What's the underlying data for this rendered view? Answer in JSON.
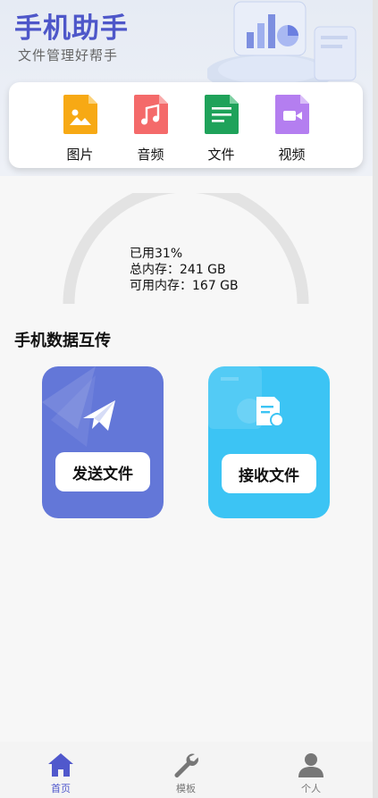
{
  "header": {
    "title": "手机助手",
    "subtitle": "文件管理好帮手"
  },
  "categories": [
    {
      "label": "图片",
      "icon": "image-file-icon",
      "color": "#f7a914"
    },
    {
      "label": "音频",
      "icon": "audio-file-icon",
      "color": "#f46a6a"
    },
    {
      "label": "文件",
      "icon": "document-file-icon",
      "color": "#1fa25a"
    },
    {
      "label": "视频",
      "icon": "video-file-icon",
      "color": "#b47ef0"
    }
  ],
  "storage": {
    "used_label": "已用31%",
    "used_fraction": 0.31,
    "total_line": "总内存：241 GB",
    "free_line": "可用内存：167 GB"
  },
  "transfer": {
    "title": "手机数据互传",
    "send_label": "发送文件",
    "receive_label": "接收文件",
    "send_color": "#6377d8",
    "receive_color": "#3cc4f4"
  },
  "tabbar": {
    "items": [
      {
        "label": "首页",
        "icon": "home-icon",
        "active": true
      },
      {
        "label": "模板",
        "icon": "wrench-icon",
        "active": false
      },
      {
        "label": "个人",
        "icon": "person-icon",
        "active": false
      }
    ],
    "active_color": "#5058cc"
  }
}
